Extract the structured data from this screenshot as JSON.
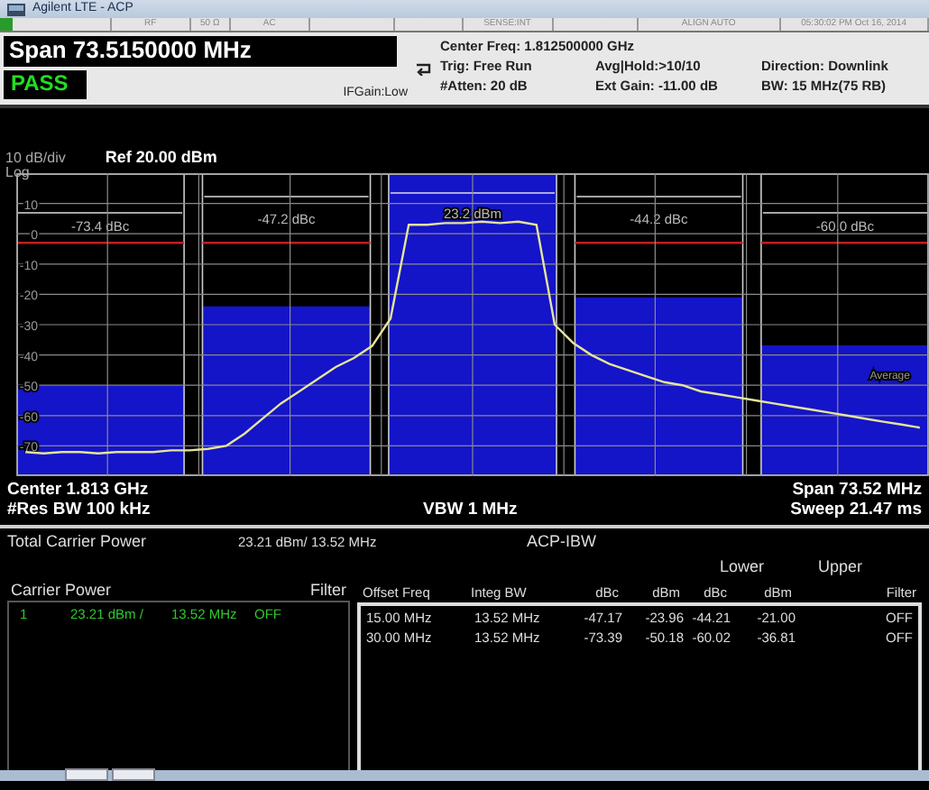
{
  "window": {
    "title": "Agilent LTE - ACP"
  },
  "status_bar": [
    {
      "text": "RF"
    },
    {
      "text": "50 Ω"
    },
    {
      "text": "AC"
    },
    {
      "text": "SENSE:INT"
    },
    {
      "text": "ALIGN AUTO"
    },
    {
      "text": "05:30:02 PM Oct 16, 2014"
    }
  ],
  "header": {
    "span": "Span 73.5150000 MHz",
    "verdict": {
      "text": "PASS",
      "kind": "pass"
    },
    "if_gain": "IFGain:Low",
    "info": [
      [
        "Center Freq: 1.812500000 GHz"
      ],
      [
        "Trig: Free Run",
        "Avg|Hold:>10/10",
        "Direction: Downlink"
      ],
      [
        "#Atten: 20 dB",
        "Ext Gain: -11.00 dB",
        "BW: 15 MHz(75 RB)"
      ]
    ]
  },
  "graph": {
    "scale": "10 dB/div",
    "scale_type": "Log",
    "reference": "Ref 20.00 dBm",
    "chart_data": {
      "type": "line",
      "grid": true,
      "ylim": [
        -80,
        20
      ],
      "yticks": [
        10,
        0,
        -10,
        -20,
        -30,
        -40,
        -50,
        -60,
        -70
      ],
      "categories": [
        null,
        null,
        null,
        null,
        null,
        null,
        null,
        null,
        null,
        null,
        null,
        null,
        null,
        null,
        null,
        null,
        null,
        null,
        null,
        null,
        null,
        null,
        null,
        null,
        null,
        null,
        null,
        null,
        null,
        null,
        null,
        null,
        null,
        null,
        null,
        null,
        null,
        null,
        null,
        null,
        null,
        null,
        null,
        null,
        null,
        null,
        null,
        null,
        null,
        null
      ],
      "series": [
        {
          "color": "#e6e49a",
          "values": [
            -72,
            -72.5,
            -72,
            -72,
            -72.5,
            -72,
            -72,
            -72,
            -71.5,
            -71.5,
            -71,
            -70,
            -66,
            -61,
            -56,
            -52,
            -48,
            -44,
            -41,
            -37,
            -28,
            3,
            3,
            3.5,
            3.5,
            4,
            3.5,
            4,
            3,
            -30,
            -36,
            -40,
            -43,
            -45,
            -47,
            -49,
            -50,
            -52,
            -53,
            -54,
            -55,
            -56,
            -57,
            -58,
            -59,
            -60,
            -61,
            -62,
            -63,
            -64
          ]
        }
      ]
    },
    "bands": [
      {
        "kind": "offset",
        "label": "-73.4 dBc"
      },
      {
        "kind": "offset",
        "label": "-47.2 dBc"
      },
      {
        "kind": "carrier",
        "label": "23.2 dBm"
      },
      {
        "kind": "offset",
        "label": "-44.2 dBc"
      },
      {
        "kind": "offset",
        "label": "-60.0 dBc"
      }
    ],
    "trace_label": "Average",
    "footer": {
      "left": [
        "Center 1.813 GHz",
        "#Res BW 100 kHz"
      ],
      "center": [
        "VBW 1 MHz"
      ],
      "right": [
        "Span 73.52 MHz",
        "Sweep 21.47 ms"
      ]
    }
  },
  "results": {
    "total_label": "Total Carrier Power",
    "total_value": "23.21 dBm/ 13.52 MHz",
    "title": "ACP-IBW",
    "carrier_headers": [
      "Carrier Power",
      "Filter"
    ],
    "carriers": [
      {
        "index": "1",
        "power": "23.21 dBm /",
        "bandwidth": "13.52 MHz",
        "filter": "OFF"
      }
    ],
    "groups": [
      "Lower",
      "Upper"
    ],
    "columns": [
      "Offset Freq",
      "Integ BW",
      "dBc",
      "dBm",
      "dBc",
      "dBm",
      "Filter"
    ],
    "rows": [
      [
        "15.00 MHz",
        "13.52 MHz",
        "-47.17",
        "-23.96",
        "-44.21",
        "-21.00",
        "OFF"
      ],
      [
        "30.00 MHz",
        "13.52 MHz",
        "-73.39",
        "-50.18",
        "-60.02",
        "-36.81",
        "OFF"
      ]
    ]
  }
}
